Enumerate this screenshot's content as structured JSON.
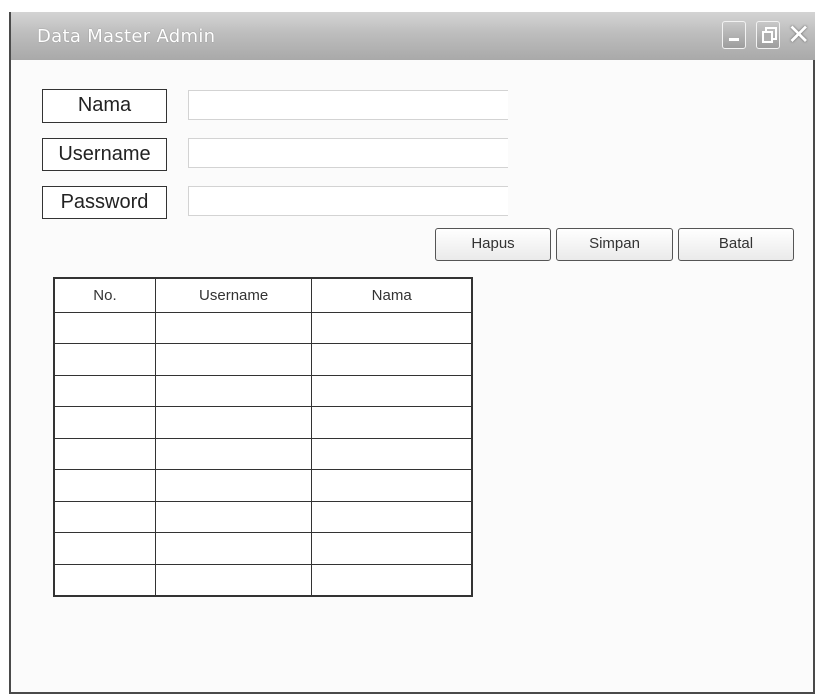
{
  "window": {
    "title": "Data Master Admin",
    "controls": {
      "minimize": "minimize-icon",
      "maximize": "restore-icon",
      "close": "close-icon"
    }
  },
  "form": {
    "nama_label": "Nama",
    "username_label": "Username",
    "password_label": "Password",
    "nama_value": "",
    "username_value": "",
    "password_value": ""
  },
  "buttons": {
    "hapus": "Hapus",
    "simpan": "Simpan",
    "batal": "Batal"
  },
  "table": {
    "headers": [
      "No.",
      "Username",
      "Nama"
    ],
    "rows": [
      [
        "",
        "",
        ""
      ],
      [
        "",
        "",
        ""
      ],
      [
        "",
        "",
        ""
      ],
      [
        "",
        "",
        ""
      ],
      [
        "",
        "",
        ""
      ],
      [
        "",
        "",
        ""
      ],
      [
        "",
        "",
        ""
      ],
      [
        "",
        "",
        ""
      ],
      [
        "",
        "",
        ""
      ]
    ]
  }
}
